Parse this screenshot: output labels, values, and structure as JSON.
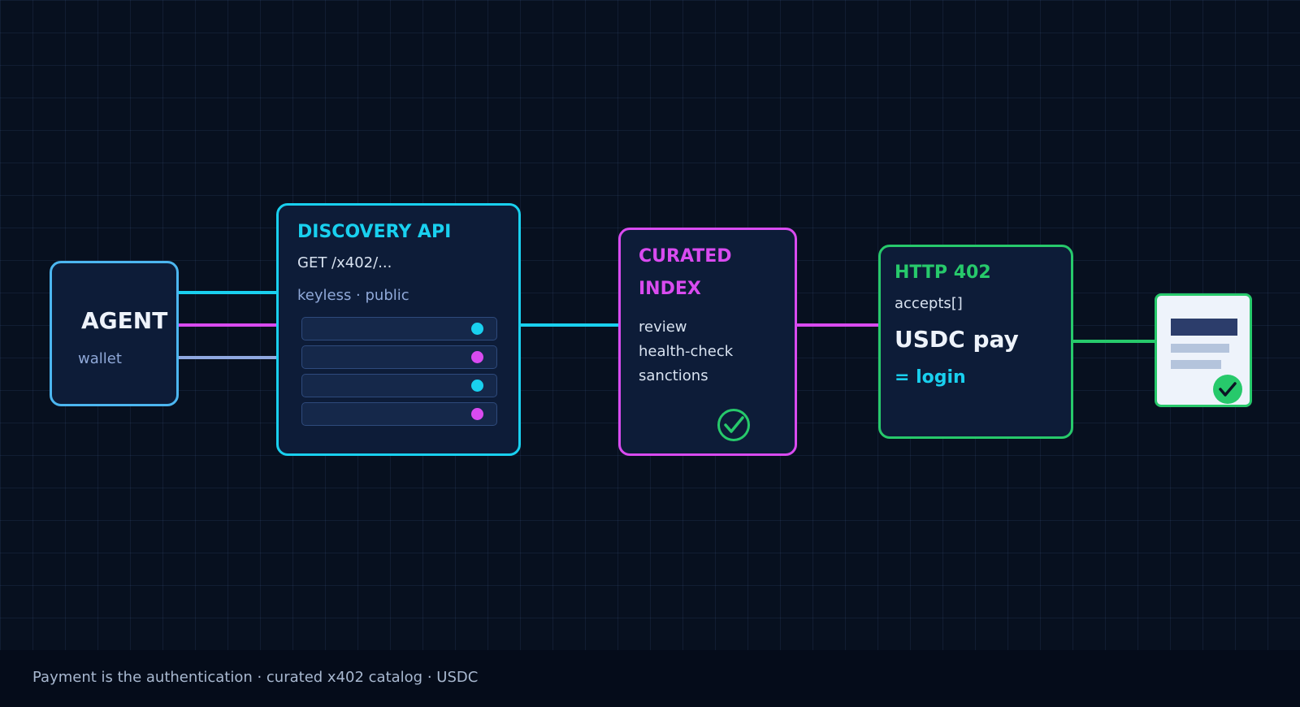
{
  "colors": {
    "background": "#07101f",
    "agent": "#4cb6f0",
    "cyan": "#19d0ef",
    "magenta": "#d94bf0",
    "green": "#27c96b",
    "lavender": "#8fa8e0"
  },
  "agent": {
    "title": "AGENT",
    "subtitle": "wallet"
  },
  "discovery": {
    "title": "DISCOVERY API",
    "endpoint": "GET /x402/...",
    "access": "keyless · public",
    "rows": [
      {
        "dot_color": "#19d0ef"
      },
      {
        "dot_color": "#d94bf0"
      },
      {
        "dot_color": "#19d0ef"
      },
      {
        "dot_color": "#d94bf0"
      }
    ]
  },
  "curated": {
    "title_line1": "CURATED",
    "title_line2": "INDEX",
    "checks": [
      "review",
      "health-check",
      "sanctions"
    ],
    "icon": "check-circle-icon"
  },
  "payment": {
    "title": "HTTP 402",
    "field": "accepts[]",
    "main": "USDC pay",
    "result": "= login"
  },
  "document": {
    "icon": "document-check-icon"
  },
  "footer": {
    "caption": "Payment is the authentication · curated x402 catalog · USDC"
  }
}
